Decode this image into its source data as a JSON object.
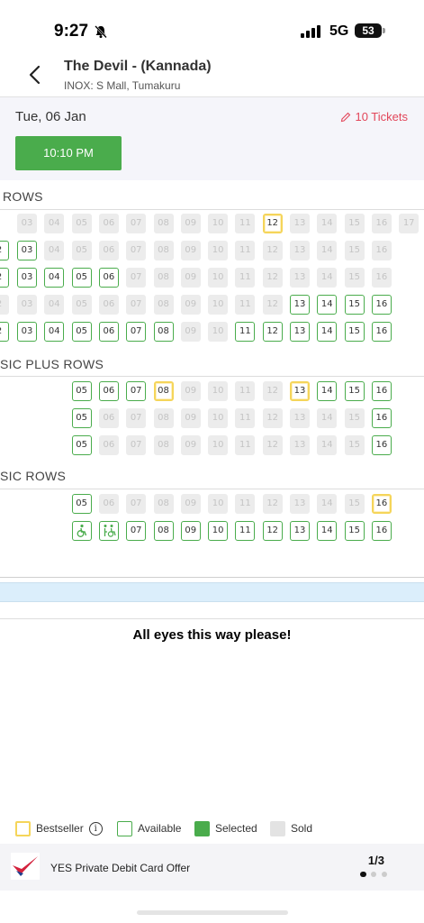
{
  "status_bar": {
    "time": "9:27",
    "network": "5G",
    "battery": "53"
  },
  "header": {
    "title": "The Devil - (Kannada)",
    "venue": "INOX: S Mall, Tumakuru"
  },
  "date_band": {
    "date": "Tue, 06 Jan",
    "tickets": "10 Tickets",
    "showtime": "10:10 PM"
  },
  "sections": [
    {
      "label": "ROWS",
      "rows": [
        {
          "seats": [
            {
              "n": "03",
              "s": "sold"
            },
            {
              "n": "04",
              "s": "sold"
            },
            {
              "n": "05",
              "s": "sold"
            },
            {
              "n": "06",
              "s": "sold"
            },
            {
              "n": "07",
              "s": "sold"
            },
            {
              "n": "08",
              "s": "sold"
            },
            {
              "n": "09",
              "s": "sold"
            },
            {
              "n": "10",
              "s": "sold"
            },
            {
              "n": "11",
              "s": "sold"
            },
            {
              "n": "12",
              "s": "bestseller"
            },
            {
              "n": "13",
              "s": "sold"
            },
            {
              "n": "14",
              "s": "sold"
            },
            {
              "n": "15",
              "s": "sold"
            },
            {
              "n": "16",
              "s": "sold"
            },
            {
              "n": "17",
              "s": "sold"
            }
          ]
        },
        {
          "seats": [
            {
              "n": "2",
              "s": "available",
              "edge": true
            },
            {
              "n": "03",
              "s": "available"
            },
            {
              "n": "04",
              "s": "sold"
            },
            {
              "n": "05",
              "s": "sold"
            },
            {
              "n": "06",
              "s": "sold"
            },
            {
              "n": "07",
              "s": "sold"
            },
            {
              "n": "08",
              "s": "sold"
            },
            {
              "n": "09",
              "s": "sold"
            },
            {
              "n": "10",
              "s": "sold"
            },
            {
              "n": "11",
              "s": "sold"
            },
            {
              "n": "12",
              "s": "sold"
            },
            {
              "n": "13",
              "s": "sold"
            },
            {
              "n": "14",
              "s": "sold"
            },
            {
              "n": "15",
              "s": "sold"
            },
            {
              "n": "16",
              "s": "sold"
            }
          ]
        },
        {
          "seats": [
            {
              "n": "2",
              "s": "available",
              "edge": true
            },
            {
              "n": "03",
              "s": "available"
            },
            {
              "n": "04",
              "s": "available"
            },
            {
              "n": "05",
              "s": "available"
            },
            {
              "n": "06",
              "s": "available"
            },
            {
              "n": "07",
              "s": "sold"
            },
            {
              "n": "08",
              "s": "sold"
            },
            {
              "n": "09",
              "s": "sold"
            },
            {
              "n": "10",
              "s": "sold"
            },
            {
              "n": "11",
              "s": "sold"
            },
            {
              "n": "12",
              "s": "sold"
            },
            {
              "n": "13",
              "s": "sold"
            },
            {
              "n": "14",
              "s": "sold"
            },
            {
              "n": "15",
              "s": "sold"
            },
            {
              "n": "16",
              "s": "sold"
            }
          ]
        },
        {
          "seats": [
            {
              "n": "2",
              "s": "sold",
              "edge": true
            },
            {
              "n": "03",
              "s": "sold"
            },
            {
              "n": "04",
              "s": "sold"
            },
            {
              "n": "05",
              "s": "sold"
            },
            {
              "n": "06",
              "s": "sold"
            },
            {
              "n": "07",
              "s": "sold"
            },
            {
              "n": "08",
              "s": "sold"
            },
            {
              "n": "09",
              "s": "sold"
            },
            {
              "n": "10",
              "s": "sold"
            },
            {
              "n": "11",
              "s": "sold"
            },
            {
              "n": "12",
              "s": "sold"
            },
            {
              "n": "13",
              "s": "available"
            },
            {
              "n": "14",
              "s": "available"
            },
            {
              "n": "15",
              "s": "available"
            },
            {
              "n": "16",
              "s": "available"
            }
          ]
        },
        {
          "seats": [
            {
              "n": "2",
              "s": "available",
              "edge": true
            },
            {
              "n": "03",
              "s": "available"
            },
            {
              "n": "04",
              "s": "available"
            },
            {
              "n": "05",
              "s": "available"
            },
            {
              "n": "06",
              "s": "available"
            },
            {
              "n": "07",
              "s": "available"
            },
            {
              "n": "08",
              "s": "available"
            },
            {
              "n": "09",
              "s": "sold"
            },
            {
              "n": "10",
              "s": "sold"
            },
            {
              "n": "11",
              "s": "available"
            },
            {
              "n": "12",
              "s": "available"
            },
            {
              "n": "13",
              "s": "available"
            },
            {
              "n": "14",
              "s": "available"
            },
            {
              "n": "15",
              "s": "available"
            },
            {
              "n": "16",
              "s": "available"
            }
          ]
        }
      ]
    },
    {
      "label": "SIC PLUS ROWS",
      "rows": [
        {
          "seats": [
            {
              "n": "05",
              "s": "available"
            },
            {
              "n": "06",
              "s": "available"
            },
            {
              "n": "07",
              "s": "available"
            },
            {
              "n": "08",
              "s": "bestseller"
            },
            {
              "n": "09",
              "s": "sold"
            },
            {
              "n": "10",
              "s": "sold"
            },
            {
              "n": "11",
              "s": "sold"
            },
            {
              "n": "12",
              "s": "sold"
            },
            {
              "n": "13",
              "s": "bestseller"
            },
            {
              "n": "14",
              "s": "available"
            },
            {
              "n": "15",
              "s": "available"
            },
            {
              "n": "16",
              "s": "available"
            }
          ]
        },
        {
          "seats": [
            {
              "n": "05",
              "s": "available"
            },
            {
              "n": "06",
              "s": "sold"
            },
            {
              "n": "07",
              "s": "sold"
            },
            {
              "n": "08",
              "s": "sold"
            },
            {
              "n": "09",
              "s": "sold"
            },
            {
              "n": "10",
              "s": "sold"
            },
            {
              "n": "11",
              "s": "sold"
            },
            {
              "n": "12",
              "s": "sold"
            },
            {
              "n": "13",
              "s": "sold"
            },
            {
              "n": "14",
              "s": "sold"
            },
            {
              "n": "15",
              "s": "sold"
            },
            {
              "n": "16",
              "s": "available"
            }
          ]
        },
        {
          "seats": [
            {
              "n": "05",
              "s": "available"
            },
            {
              "n": "06",
              "s": "sold"
            },
            {
              "n": "07",
              "s": "sold"
            },
            {
              "n": "08",
              "s": "sold"
            },
            {
              "n": "09",
              "s": "sold"
            },
            {
              "n": "10",
              "s": "sold"
            },
            {
              "n": "11",
              "s": "sold"
            },
            {
              "n": "12",
              "s": "sold"
            },
            {
              "n": "13",
              "s": "sold"
            },
            {
              "n": "14",
              "s": "sold"
            },
            {
              "n": "15",
              "s": "sold"
            },
            {
              "n": "16",
              "s": "available"
            }
          ]
        }
      ]
    },
    {
      "label": "SIC ROWS",
      "rows": [
        {
          "seats": [
            {
              "n": "05",
              "s": "available"
            },
            {
              "n": "06",
              "s": "sold"
            },
            {
              "n": "07",
              "s": "sold"
            },
            {
              "n": "08",
              "s": "sold"
            },
            {
              "n": "09",
              "s": "sold"
            },
            {
              "n": "10",
              "s": "sold"
            },
            {
              "n": "11",
              "s": "sold"
            },
            {
              "n": "12",
              "s": "sold"
            },
            {
              "n": "13",
              "s": "sold"
            },
            {
              "n": "14",
              "s": "sold"
            },
            {
              "n": "15",
              "s": "sold"
            },
            {
              "n": "16",
              "s": "bestseller"
            }
          ]
        },
        {
          "seats": [
            {
              "n": "",
              "s": "available",
              "icon": "wheelchair-icon"
            },
            {
              "n": "",
              "s": "available",
              "icon": "companion-seat-icon"
            },
            {
              "n": "07",
              "s": "available"
            },
            {
              "n": "08",
              "s": "available"
            },
            {
              "n": "09",
              "s": "available"
            },
            {
              "n": "10",
              "s": "available"
            },
            {
              "n": "11",
              "s": "available"
            },
            {
              "n": "12",
              "s": "available"
            },
            {
              "n": "13",
              "s": "available"
            },
            {
              "n": "14",
              "s": "available"
            },
            {
              "n": "15",
              "s": "available"
            },
            {
              "n": "16",
              "s": "available"
            }
          ]
        }
      ]
    }
  ],
  "screen": {
    "caption": "All eyes this way please!"
  },
  "legend": {
    "bestseller": "Bestseller",
    "available": "Available",
    "selected": "Selected",
    "sold": "Sold"
  },
  "offer": {
    "text": "YES Private Debit Card Offer",
    "count": "1/3"
  },
  "colors": {
    "available": "#4aac4c",
    "bestseller": "#f5d55a",
    "sold": "#ececec",
    "accent": "#e2465a",
    "screen": "#dbeefb"
  }
}
